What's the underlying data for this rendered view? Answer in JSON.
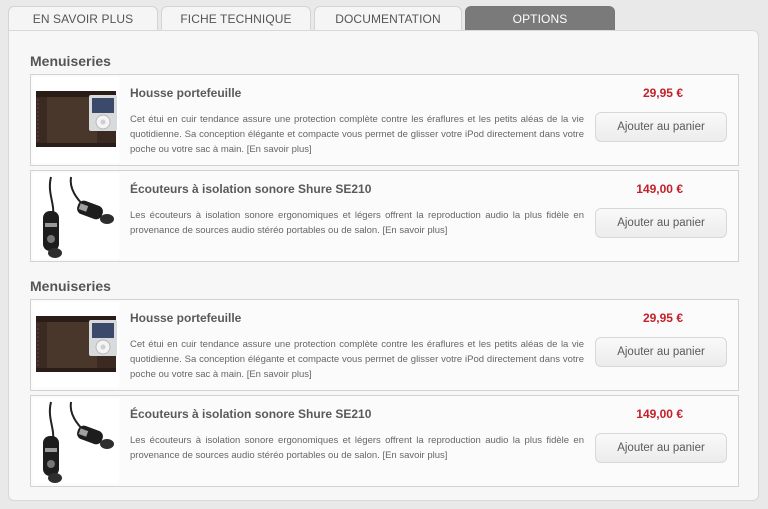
{
  "tabs": [
    {
      "label": "EN SAVOIR PLUS"
    },
    {
      "label": "FICHE TECHNIQUE"
    },
    {
      "label": "DOCUMENTATION"
    },
    {
      "label": "OPTIONS"
    }
  ],
  "active_tab": "OPTIONS",
  "sections": [
    {
      "title": "Menuiseries",
      "products": [
        {
          "name": "Housse portefeuille",
          "description": "Cet étui en cuir tendance assure une protection complète contre les éraflures et les petits aléas de la vie quotidienne. Sa conception élégante et compacte vous permet de glisser votre iPod directement dans votre poche ou votre sac à main. [En savoir plus]",
          "price": "29,95 €",
          "button_label": "Ajouter au panier",
          "thumbnail_icon": "leather-wallet-case-image"
        },
        {
          "name": "Écouteurs à isolation sonore Shure SE210",
          "description": "Les écouteurs à isolation sonore ergonomiques et légers offrent la reproduction audio la plus fidèle en provenance de sources audio stéréo portables ou de salon. [En savoir plus]",
          "price": "149,00 €",
          "button_label": "Ajouter au panier",
          "thumbnail_icon": "earphones-image"
        }
      ]
    },
    {
      "title": "Menuiseries",
      "products": [
        {
          "name": "Housse portefeuille",
          "description": "Cet étui en cuir tendance assure une protection complète contre les éraflures et les petits aléas de la vie quotidienne. Sa conception élégante et compacte vous permet de glisser votre iPod directement dans votre poche ou votre sac à main. [En savoir plus]",
          "price": "29,95 €",
          "button_label": "Ajouter au panier",
          "thumbnail_icon": "leather-wallet-case-image"
        },
        {
          "name": "Écouteurs à isolation sonore Shure SE210",
          "description": "Les écouteurs à isolation sonore ergonomiques et légers offrent la reproduction audio la plus fidèle en provenance de sources audio stéréo portables ou de salon. [En savoir plus]",
          "price": "149,00 €",
          "button_label": "Ajouter au panier",
          "thumbnail_icon": "earphones-image"
        }
      ]
    }
  ],
  "colors": {
    "price": "#c3202a",
    "active_tab_bg": "#7a7a7a",
    "page_bg": "#e9e9e9"
  }
}
